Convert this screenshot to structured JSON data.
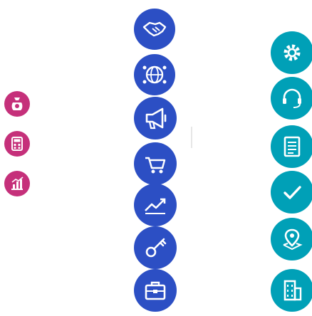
{
  "colors": {
    "left": "#c5307a",
    "middle": "#2c4fc4",
    "right": "#00a0b7",
    "glyph": "#ffffff"
  },
  "columns": [
    {
      "name": "left",
      "icons": [
        "money-bag-icon",
        "calculator-icon",
        "bar-chart-icon"
      ]
    },
    {
      "name": "middle",
      "icons": [
        "handshake-icon",
        "globe-network-icon",
        "megaphone-icon",
        "shopping-cart-icon",
        "growth-chart-icon",
        "key-icon",
        "briefcase-icon"
      ]
    },
    {
      "name": "right",
      "icons": [
        "gear-icon",
        "support-headset-icon",
        "document-icon",
        "checkmark-icon",
        "map-location-icon",
        "building-icon"
      ]
    }
  ]
}
